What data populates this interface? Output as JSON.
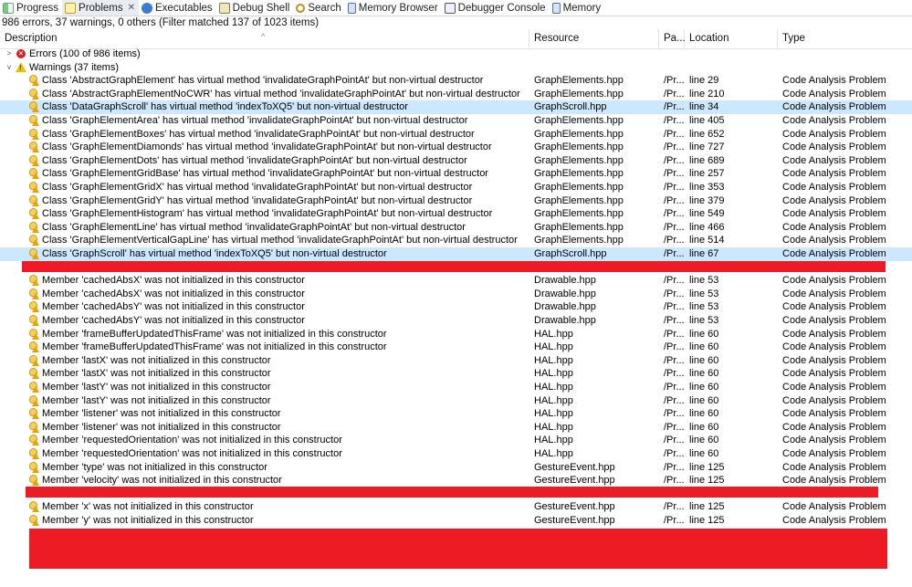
{
  "tabs": [
    {
      "label": "Progress",
      "icon": "progress-icon",
      "active": false
    },
    {
      "label": "Problems",
      "icon": "problems-icon",
      "active": true
    },
    {
      "label": "Executables",
      "icon": "executables-icon",
      "active": false
    },
    {
      "label": "Debug Shell",
      "icon": "debug-shell-icon",
      "active": false
    },
    {
      "label": "Search",
      "icon": "search-icon",
      "active": false
    },
    {
      "label": "Memory Browser",
      "icon": "memory-browser-icon",
      "active": false
    },
    {
      "label": "Debugger Console",
      "icon": "debugger-console-icon",
      "active": false
    },
    {
      "label": "Memory",
      "icon": "memory-icon",
      "active": false
    }
  ],
  "summary": "986 errors, 37 warnings, 0 others (Filter matched 137 of 1023 items)",
  "columns": {
    "description": "Description",
    "resource": "Resource",
    "path": "Pa...",
    "location": "Location",
    "type": "Type"
  },
  "groups": {
    "errors": {
      "label": "Errors (100 of 986 items)",
      "expanded": false
    },
    "warnings": {
      "label": "Warnings (37 items)",
      "expanded": true
    }
  },
  "warnings": [
    {
      "desc": "Class 'AbstractGraphElement' has virtual method 'invalidateGraphPointAt' but non-virtual destructor",
      "res": "GraphElements.hpp",
      "path": "/Pr...",
      "loc": "line 29",
      "type": "Code Analysis Problem"
    },
    {
      "desc": "Class 'AbstractGraphElementNoCWR' has virtual method 'invalidateGraphPointAt' but non-virtual destructor",
      "res": "GraphElements.hpp",
      "path": "/Pr...",
      "loc": "line 210",
      "type": "Code Analysis Problem"
    },
    {
      "desc": "Class 'DataGraphScroll' has virtual method 'indexToXQ5' but non-virtual destructor",
      "res": "GraphScroll.hpp",
      "path": "/Pr...",
      "loc": "line 34",
      "type": "Code Analysis Problem",
      "selected": true
    },
    {
      "desc": "Class 'GraphElementArea' has virtual method 'invalidateGraphPointAt' but non-virtual destructor",
      "res": "GraphElements.hpp",
      "path": "/Pr...",
      "loc": "line 405",
      "type": "Code Analysis Problem"
    },
    {
      "desc": "Class 'GraphElementBoxes' has virtual method 'invalidateGraphPointAt' but non-virtual destructor",
      "res": "GraphElements.hpp",
      "path": "/Pr...",
      "loc": "line 652",
      "type": "Code Analysis Problem"
    },
    {
      "desc": "Class 'GraphElementDiamonds' has virtual method 'invalidateGraphPointAt' but non-virtual destructor",
      "res": "GraphElements.hpp",
      "path": "/Pr...",
      "loc": "line 727",
      "type": "Code Analysis Problem"
    },
    {
      "desc": "Class 'GraphElementDots' has virtual method 'invalidateGraphPointAt' but non-virtual destructor",
      "res": "GraphElements.hpp",
      "path": "/Pr...",
      "loc": "line 689",
      "type": "Code Analysis Problem"
    },
    {
      "desc": "Class 'GraphElementGridBase' has virtual method 'invalidateGraphPointAt' but non-virtual destructor",
      "res": "GraphElements.hpp",
      "path": "/Pr...",
      "loc": "line 257",
      "type": "Code Analysis Problem"
    },
    {
      "desc": "Class 'GraphElementGridX' has virtual method 'invalidateGraphPointAt' but non-virtual destructor",
      "res": "GraphElements.hpp",
      "path": "/Pr...",
      "loc": "line 353",
      "type": "Code Analysis Problem"
    },
    {
      "desc": "Class 'GraphElementGridY' has virtual method 'invalidateGraphPointAt' but non-virtual destructor",
      "res": "GraphElements.hpp",
      "path": "/Pr...",
      "loc": "line 379",
      "type": "Code Analysis Problem"
    },
    {
      "desc": "Class 'GraphElementHistogram' has virtual method 'invalidateGraphPointAt' but non-virtual destructor",
      "res": "GraphElements.hpp",
      "path": "/Pr...",
      "loc": "line 549",
      "type": "Code Analysis Problem"
    },
    {
      "desc": "Class 'GraphElementLine' has virtual method 'invalidateGraphPointAt' but non-virtual destructor",
      "res": "GraphElements.hpp",
      "path": "/Pr...",
      "loc": "line 466",
      "type": "Code Analysis Problem"
    },
    {
      "desc": "Class 'GraphElementVerticalGapLine' has virtual method 'invalidateGraphPointAt' but non-virtual destructor",
      "res": "GraphElements.hpp",
      "path": "/Pr...",
      "loc": "line 514",
      "type": "Code Analysis Problem"
    },
    {
      "desc": "Class 'GraphScroll' has virtual method 'indexToXQ5' but non-virtual destructor",
      "res": "GraphScroll.hpp",
      "path": "/Pr...",
      "loc": "line 67",
      "type": "Code Analysis Problem",
      "selected": true
    },
    {
      "desc": "",
      "res": "",
      "path": "",
      "loc": "",
      "type": "",
      "redacted": true
    },
    {
      "desc": "Member 'cachedAbsX' was not initialized in this constructor",
      "res": "Drawable.hpp",
      "path": "/Pr...",
      "loc": "line 53",
      "type": "Code Analysis Problem"
    },
    {
      "desc": "Member 'cachedAbsX' was not initialized in this constructor",
      "res": "Drawable.hpp",
      "path": "/Pr...",
      "loc": "line 53",
      "type": "Code Analysis Problem"
    },
    {
      "desc": "Member 'cachedAbsY' was not initialized in this constructor",
      "res": "Drawable.hpp",
      "path": "/Pr...",
      "loc": "line 53",
      "type": "Code Analysis Problem"
    },
    {
      "desc": "Member 'cachedAbsY' was not initialized in this constructor",
      "res": "Drawable.hpp",
      "path": "/Pr...",
      "loc": "line 53",
      "type": "Code Analysis Problem"
    },
    {
      "desc": "Member 'frameBufferUpdatedThisFrame' was not initialized in this constructor",
      "res": "HAL.hpp",
      "path": "/Pr...",
      "loc": "line 60",
      "type": "Code Analysis Problem"
    },
    {
      "desc": "Member 'frameBufferUpdatedThisFrame' was not initialized in this constructor",
      "res": "HAL.hpp",
      "path": "/Pr...",
      "loc": "line 60",
      "type": "Code Analysis Problem"
    },
    {
      "desc": "Member 'lastX' was not initialized in this constructor",
      "res": "HAL.hpp",
      "path": "/Pr...",
      "loc": "line 60",
      "type": "Code Analysis Problem"
    },
    {
      "desc": "Member 'lastX' was not initialized in this constructor",
      "res": "HAL.hpp",
      "path": "/Pr...",
      "loc": "line 60",
      "type": "Code Analysis Problem"
    },
    {
      "desc": "Member 'lastY' was not initialized in this constructor",
      "res": "HAL.hpp",
      "path": "/Pr...",
      "loc": "line 60",
      "type": "Code Analysis Problem"
    },
    {
      "desc": "Member 'lastY' was not initialized in this constructor",
      "res": "HAL.hpp",
      "path": "/Pr...",
      "loc": "line 60",
      "type": "Code Analysis Problem"
    },
    {
      "desc": "Member 'listener' was not initialized in this constructor",
      "res": "HAL.hpp",
      "path": "/Pr...",
      "loc": "line 60",
      "type": "Code Analysis Problem"
    },
    {
      "desc": "Member 'listener' was not initialized in this constructor",
      "res": "HAL.hpp",
      "path": "/Pr...",
      "loc": "line 60",
      "type": "Code Analysis Problem"
    },
    {
      "desc": "Member 'requestedOrientation' was not initialized in this constructor",
      "res": "HAL.hpp",
      "path": "/Pr...",
      "loc": "line 60",
      "type": "Code Analysis Problem"
    },
    {
      "desc": "Member 'requestedOrientation' was not initialized in this constructor",
      "res": "HAL.hpp",
      "path": "/Pr...",
      "loc": "line 60",
      "type": "Code Analysis Problem"
    },
    {
      "desc": "Member 'type' was not initialized in this constructor",
      "res": "GestureEvent.hpp",
      "path": "/Pr...",
      "loc": "line 125",
      "type": "Code Analysis Problem"
    },
    {
      "desc": "Member 'velocity' was not initialized in this constructor",
      "res": "GestureEvent.hpp",
      "path": "/Pr...",
      "loc": "line 125",
      "type": "Code Analysis Problem"
    },
    {
      "desc": "",
      "res": "",
      "path": "",
      "loc": "",
      "type": "",
      "redacted": true
    },
    {
      "desc": "Member 'x' was not initialized in this constructor",
      "res": "GestureEvent.hpp",
      "path": "/Pr...",
      "loc": "line 125",
      "type": "Code Analysis Problem"
    },
    {
      "desc": "Member 'y' was not initialized in this constructor",
      "res": "GestureEvent.hpp",
      "path": "/Pr...",
      "loc": "line 125",
      "type": "Code Analysis Problem"
    }
  ],
  "colors": {
    "selection": "#cce8ff",
    "redaction": "#ed1c24",
    "error": "#d32222",
    "warning": "#f2c200"
  }
}
